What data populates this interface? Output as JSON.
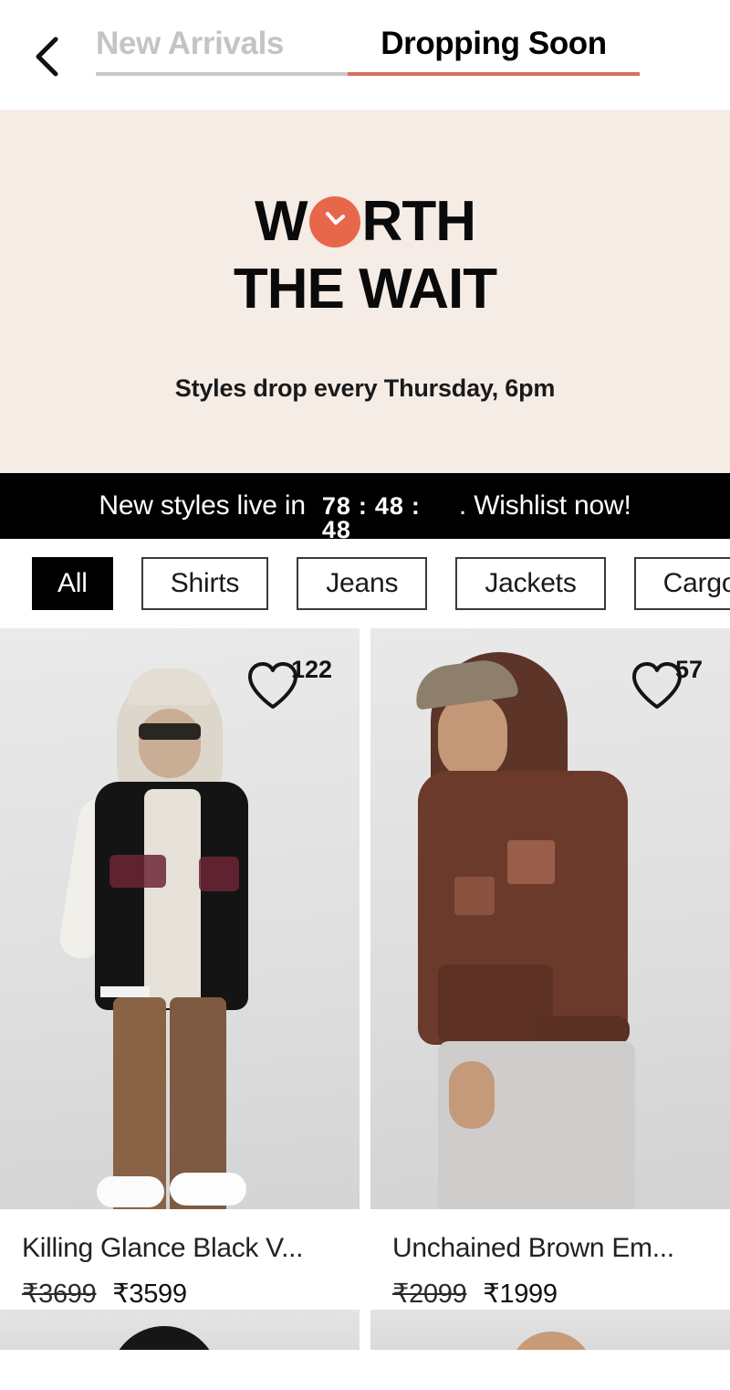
{
  "header": {
    "back_icon": "chevron-left-icon",
    "tabs": [
      {
        "label": "New Arrivals",
        "active": false
      },
      {
        "label": "Dropping Soon",
        "active": true
      }
    ],
    "active_underline_color": "#d1715a",
    "inactive_underline_color": "#c9c9c9"
  },
  "hero": {
    "background_color": "#f6ece6",
    "title_part1": "W",
    "title_part2": "RTH",
    "title_line2": "THE WAIT",
    "clock_icon": "clock-icon",
    "clock_color": "#e8674a",
    "subtitle": "Styles drop every Thursday, 6pm"
  },
  "countdown": {
    "background_color": "#000000",
    "prefix": "New styles live in",
    "hours": "78",
    "minutes": "48",
    "seconds_rolling": "48",
    "separator": ":",
    "suffix": ". Wishlist now!"
  },
  "filters": {
    "chips": [
      {
        "label": "All",
        "active": true
      },
      {
        "label": "Shirts",
        "active": false
      },
      {
        "label": "Jeans",
        "active": false
      },
      {
        "label": "Jackets",
        "active": false
      },
      {
        "label": "Cargo",
        "active": false
      }
    ]
  },
  "products": [
    {
      "title": "Killing Glance Black V...",
      "price_old": "₹3699",
      "price_new": "₹3599",
      "likes": "122",
      "like_icon": "heart-outline-icon"
    },
    {
      "title": "Unchained Brown Em...",
      "price_old": "₹2099",
      "price_new": "₹1999",
      "likes": "57",
      "like_icon": "heart-outline-icon"
    }
  ],
  "products_row2": [
    {
      "like_icon": "heart-outline-icon"
    },
    {
      "like_icon": "heart-outline-icon"
    }
  ]
}
